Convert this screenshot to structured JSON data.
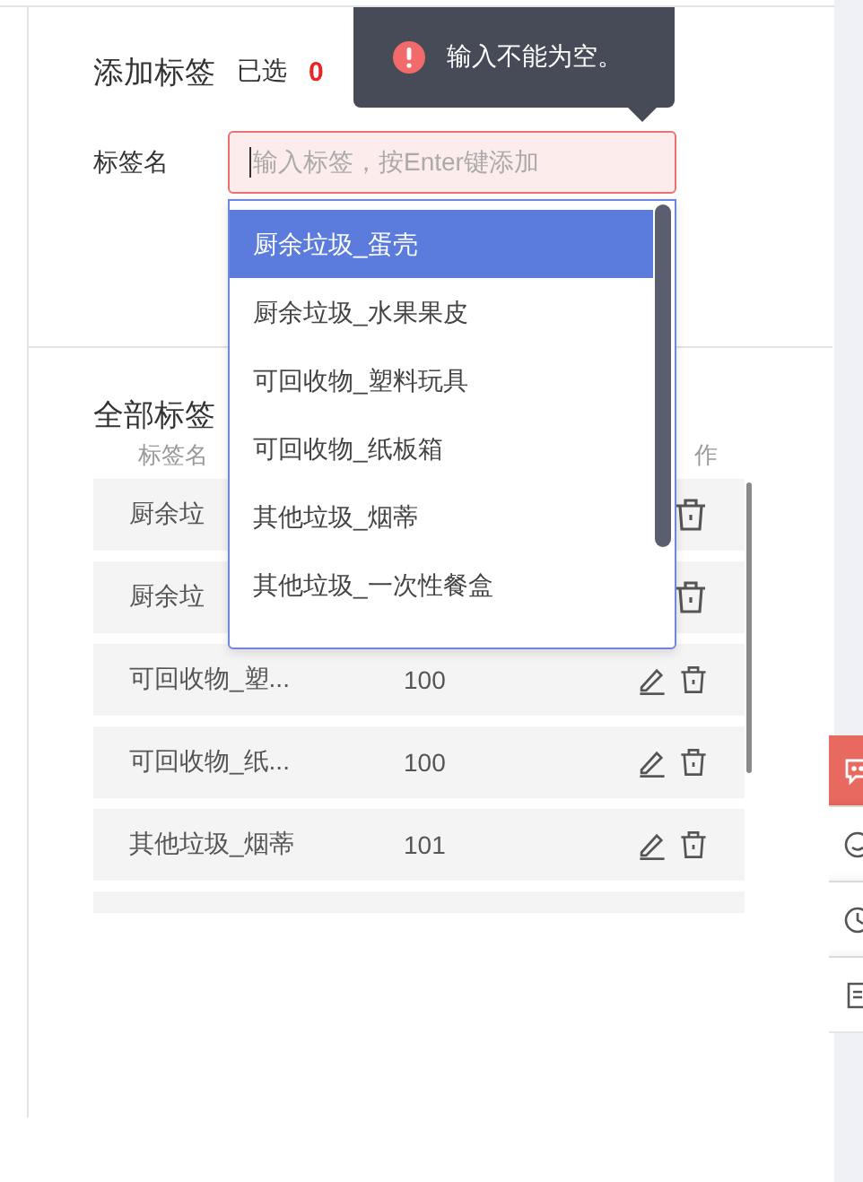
{
  "toast": {
    "kind": "error",
    "message": "输入不能为空。"
  },
  "add_section": {
    "title": "添加标签",
    "selected_label": "已选",
    "selected_count": "0",
    "field_label": "标签名",
    "input": {
      "placeholder": "输入标签，按Enter键添加",
      "invalid": true,
      "focused": true
    }
  },
  "suggestions": [
    {
      "label": "厨余垃圾_蛋壳",
      "selected": true
    },
    {
      "label": "厨余垃圾_水果果皮",
      "selected": false
    },
    {
      "label": "可回收物_塑料玩具",
      "selected": false
    },
    {
      "label": "可回收物_纸板箱",
      "selected": false
    },
    {
      "label": "其他垃圾_烟蒂",
      "selected": false
    },
    {
      "label": "其他垃圾_一次性餐盒",
      "selected": false
    }
  ],
  "all_section": {
    "title": "全部标签",
    "columns": [
      "标签名",
      "作"
    ],
    "rows": [
      {
        "kind": "covered",
        "name": "厨余垃"
      },
      {
        "kind": "covered",
        "name": "厨余垃"
      },
      {
        "kind": "full",
        "name": "可回收物_塑...",
        "count": "100"
      },
      {
        "kind": "full",
        "name": "可回收物_纸...",
        "count": "100"
      },
      {
        "kind": "full",
        "name": "其他垃圾_烟蒂",
        "count": "101"
      },
      {
        "kind": "cut"
      }
    ]
  },
  "side_toolbar": [
    {
      "kind": "chat",
      "selected": true
    },
    {
      "kind": "smile",
      "selected": false
    },
    {
      "kind": "clock",
      "selected": false
    },
    {
      "kind": "doc",
      "selected": false
    }
  ]
}
